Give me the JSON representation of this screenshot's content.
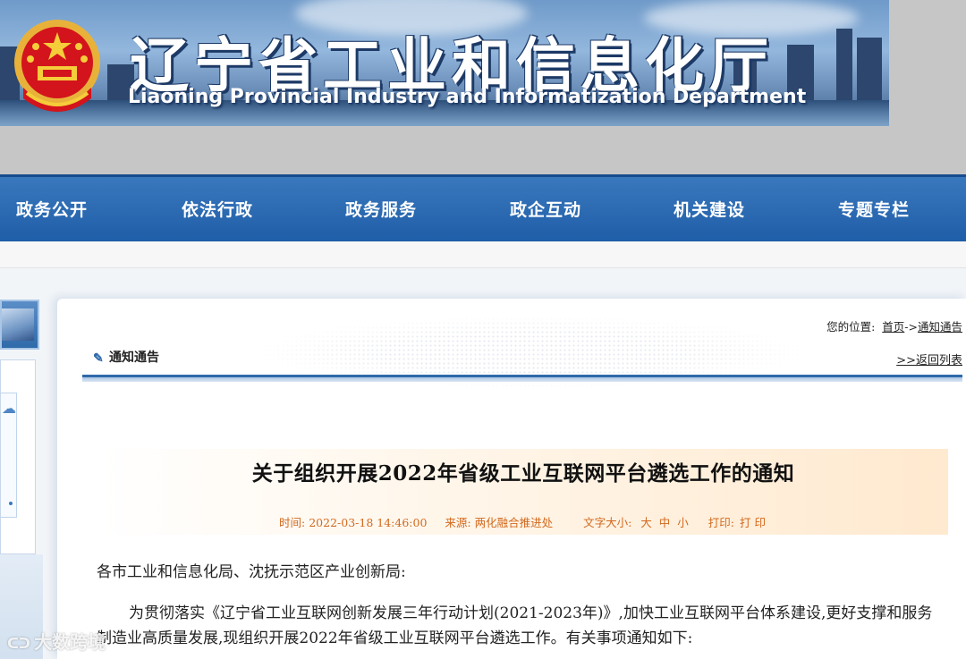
{
  "banner": {
    "title_cn": "辽宁省工业和信息化厅",
    "title_en": "Liaoning Provincial Industry and Informatization Department",
    "emblem_icon": "national-emblem-icon"
  },
  "nav": {
    "items": [
      "政务公开",
      "依法行政",
      "政务服务",
      "政企互动",
      "机关建设",
      "专题专栏"
    ]
  },
  "location": {
    "prefix": "您的位置:",
    "home": "首页",
    "separator": "->",
    "current": "通知通告"
  },
  "section": {
    "title": "通知通告",
    "back_link": ">>返回列表",
    "icon": "edit-icon"
  },
  "article": {
    "title": "关于组织开展2022年省级工业互联网平台遴选工作的通知",
    "meta": {
      "time_label": "时间:",
      "time_value": "2022-03-18 14:46:00",
      "source_label": "来源:",
      "source_value": "两化融合推进处",
      "font_size_label": "文字大小:",
      "font_large": "大",
      "font_medium": "中",
      "font_small": "小",
      "print_label": "打印:",
      "print_action": "打 印"
    },
    "salutation": "各市工业和信息化局、沈抚示范区产业创新局:",
    "paragraph1": "为贯彻落实《辽宁省工业互联网创新发展三年行动计划(2021-2023年)》,加快工业互联网平台体系建设,更好支撑和服务制造业高质量发展,现组织开展2022年省级工业互联网平台遴选工作。有关事项通知如下:"
  },
  "watermark": {
    "text": "大数跨境"
  },
  "colors": {
    "nav_blue": "#1f5ea8",
    "meta_orange": "#d2691e"
  }
}
